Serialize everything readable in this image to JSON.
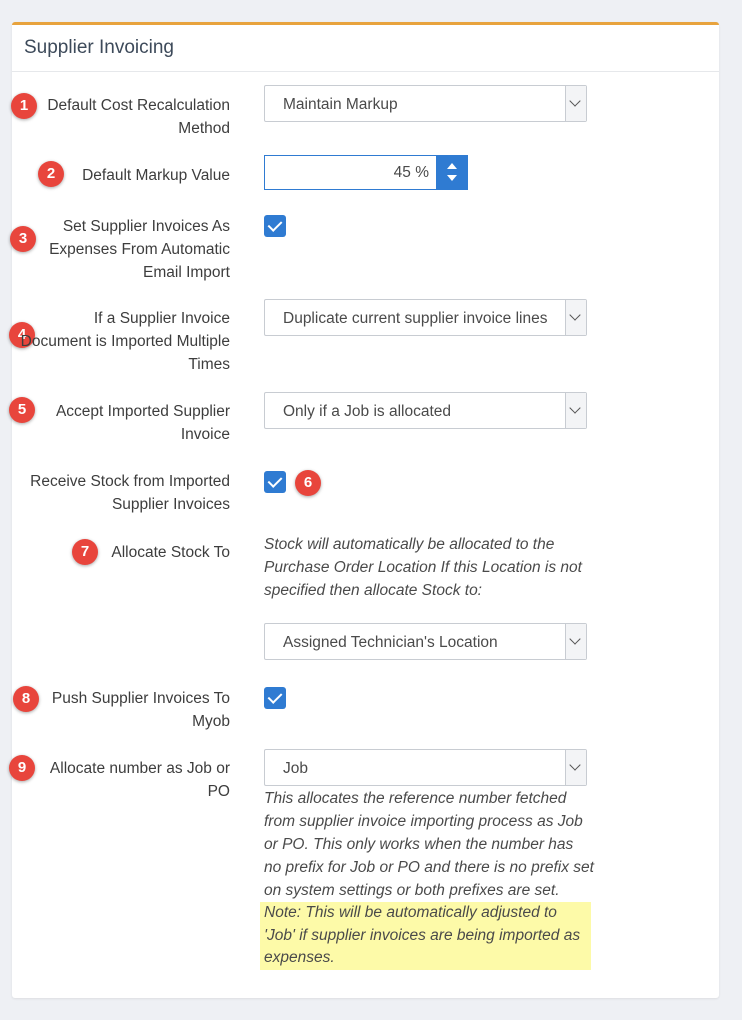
{
  "panel": {
    "title": "Supplier Invoicing"
  },
  "fields": {
    "f1": {
      "badge": "1",
      "label": "Default Cost Recalculation Method",
      "value": "Maintain Markup"
    },
    "f2": {
      "badge": "2",
      "label": "Default Markup Value",
      "value": "45 %"
    },
    "f3": {
      "badge": "3",
      "label": "Set Supplier Invoices As Expenses From Automatic Email Import",
      "checked": true
    },
    "f4": {
      "badge": "4",
      "label": "If a Supplier Invoice Document is Imported Multiple Times",
      "value": "Duplicate current supplier invoice lines"
    },
    "f5": {
      "badge": "5",
      "label": "Accept Imported Supplier Invoice",
      "value": "Only if a Job is allocated"
    },
    "f6": {
      "badge": "6",
      "label": "Receive Stock from Imported Supplier Invoices",
      "checked": true
    },
    "f7": {
      "badge": "7",
      "label": "Allocate Stock To",
      "help": "Stock will automatically be allocated to the Purchase Order Location If this Location is not specified then allocate Stock to:",
      "value": "Assigned Technician's Location"
    },
    "f8": {
      "badge": "8",
      "label": "Push Supplier Invoices To Myob",
      "checked": true
    },
    "f9": {
      "badge": "9",
      "label": "Allocate number as Job or PO",
      "value": "Job",
      "help": "This allocates the reference number fetched from supplier invoice importing process as Job or PO. This only works when the number has no prefix for Job or PO and there is no prefix set on system settings or both prefixes are set.",
      "note": "Note: This will be automatically adjusted to 'Job' if supplier invoices are being imported as expenses."
    }
  },
  "colors": {
    "accent": "#e8a33d",
    "checkbox": "#2f7bd2",
    "badge": "#e8453c",
    "note_bg": "#fdfaa8",
    "spinner": "#2f7bd2"
  },
  "icons": {
    "dropdown": "chevron-down-icon",
    "check": "check-icon",
    "spinner": "up-down-arrows-icon"
  }
}
